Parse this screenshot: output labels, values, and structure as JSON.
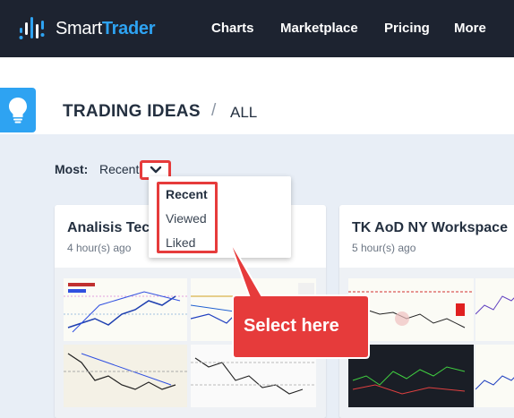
{
  "brand": {
    "name_part1": "Smart",
    "name_part2": "Trader",
    "accent": "#2ea3f2",
    "nav_bg": "#1d2330"
  },
  "nav": {
    "items": [
      "Charts",
      "Marketplace",
      "Pricing",
      "More"
    ]
  },
  "header": {
    "title": "TRADING IDEAS",
    "separator": "/",
    "filter": "ALL",
    "icon": "lightbulb-icon"
  },
  "sort": {
    "label": "Most:",
    "value": "Recent",
    "icon": "chevron-down-icon"
  },
  "dropdown": {
    "options": [
      "Recent",
      "Viewed",
      "Liked"
    ],
    "selected": "Recent"
  },
  "cards": [
    {
      "title": "Analisis Tec",
      "time": "4 hour(s) ago"
    },
    {
      "title": "TK AoD NY Workspace",
      "time": "5 hour(s) ago"
    }
  ],
  "callout": {
    "text": "Select here",
    "color": "#e63b3b"
  }
}
